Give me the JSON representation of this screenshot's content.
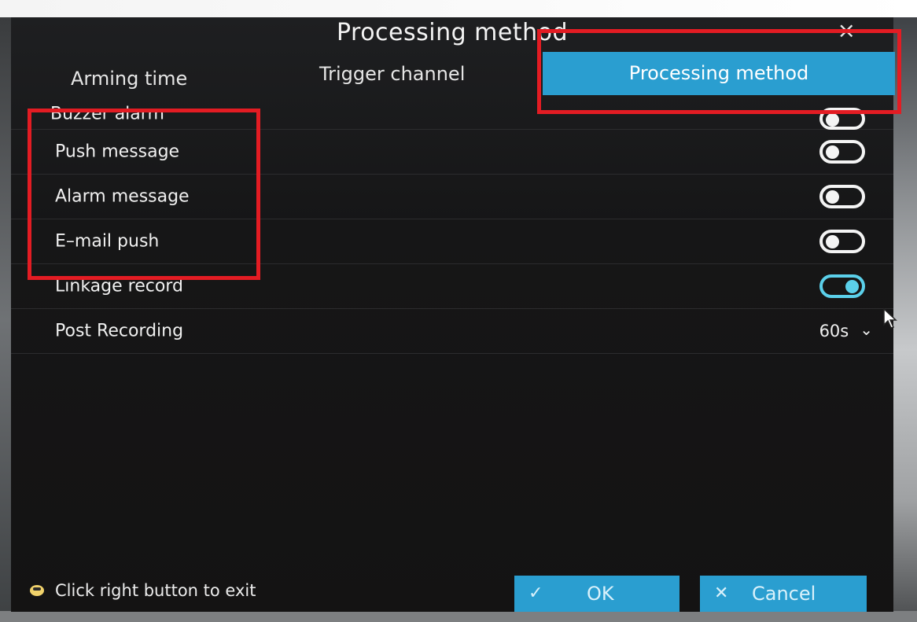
{
  "dialog": {
    "title": "Processing method",
    "close_symbol": "×"
  },
  "tabs": [
    {
      "label": "Arming time",
      "active": false
    },
    {
      "label": "Trigger channel",
      "active": false
    },
    {
      "label": "Processing method",
      "active": true
    }
  ],
  "options": [
    {
      "label": "Buzzer alarm",
      "type": "toggle",
      "on": false
    },
    {
      "label": "Push message",
      "type": "toggle",
      "on": false
    },
    {
      "label": "Alarm message",
      "type": "toggle",
      "on": false
    },
    {
      "label": "E–mail push",
      "type": "toggle",
      "on": false
    },
    {
      "label": "Linkage record",
      "type": "toggle",
      "on": true
    },
    {
      "label": "Post Recording",
      "type": "select",
      "value": "60s"
    }
  ],
  "footer": {
    "hint": "Click right button to exit",
    "hint_icon": "mouse-icon",
    "ok_label": "OK",
    "ok_icon": "✓",
    "cancel_label": "Cancel",
    "cancel_icon": "✕"
  },
  "colors": {
    "accent": "#2a9ed0",
    "toggle_on": "#5bd0ea",
    "annotation": "#e31c23"
  }
}
